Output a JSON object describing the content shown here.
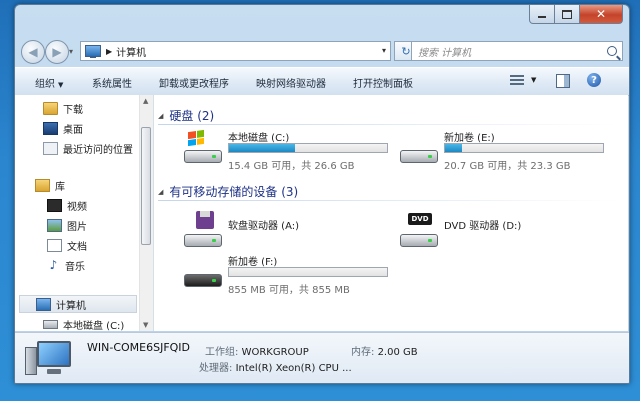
{
  "window": {
    "minimize_label": "_",
    "close_label": "✕"
  },
  "address": {
    "location": "计算机"
  },
  "search": {
    "placeholder": "搜索 计算机"
  },
  "toolbar": {
    "organize": "组织",
    "system_properties": "系统属性",
    "uninstall": "卸载或更改程序",
    "map_drive": "映射网络驱动器",
    "control_panel": "打开控制面板",
    "help": "?"
  },
  "nav": {
    "items": [
      {
        "label": "下载",
        "icon": "downloads-folder-icon"
      },
      {
        "label": "桌面",
        "icon": "desktop-icon"
      },
      {
        "label": "最近访问的位置",
        "icon": "recent-places-icon"
      },
      {
        "label": "库",
        "icon": "libraries-icon"
      },
      {
        "label": "视频",
        "icon": "videos-icon"
      },
      {
        "label": "图片",
        "icon": "pictures-icon"
      },
      {
        "label": "文档",
        "icon": "documents-icon"
      },
      {
        "label": "音乐",
        "icon": "music-icon"
      },
      {
        "label": "计算机",
        "icon": "computer-icon"
      },
      {
        "label": "本地磁盘 (C:)",
        "icon": "local-disk-icon"
      }
    ]
  },
  "groups": {
    "hdd": "硬盘 (2)",
    "removable": "有可移动存储的设备 (3)"
  },
  "drives": {
    "c": {
      "name": "本地磁盘 (C:)",
      "info": "15.4 GB 可用，共 26.6 GB",
      "used_fraction": 0.42
    },
    "e": {
      "name": "新加卷 (E:)",
      "info": "20.7 GB 可用，共 23.3 GB",
      "used_fraction": 0.11
    },
    "a": {
      "name": "软盘驱动器 (A:)"
    },
    "d": {
      "name": "DVD 驱动器 (D:)",
      "badge": "DVD"
    },
    "f": {
      "name": "新加卷 (F:)",
      "info": "855 MB 可用，共 855 MB",
      "used_fraction": 0.0
    }
  },
  "details": {
    "computer_name": "WIN-COME6SJFQID",
    "workgroup_label": "工作组:",
    "workgroup_value": "WORKGROUP",
    "memory_label": "内存:",
    "memory_value": "2.00 GB",
    "processor_label": "处理器:",
    "processor_value": "Intel(R) Xeon(R) CPU ..."
  }
}
